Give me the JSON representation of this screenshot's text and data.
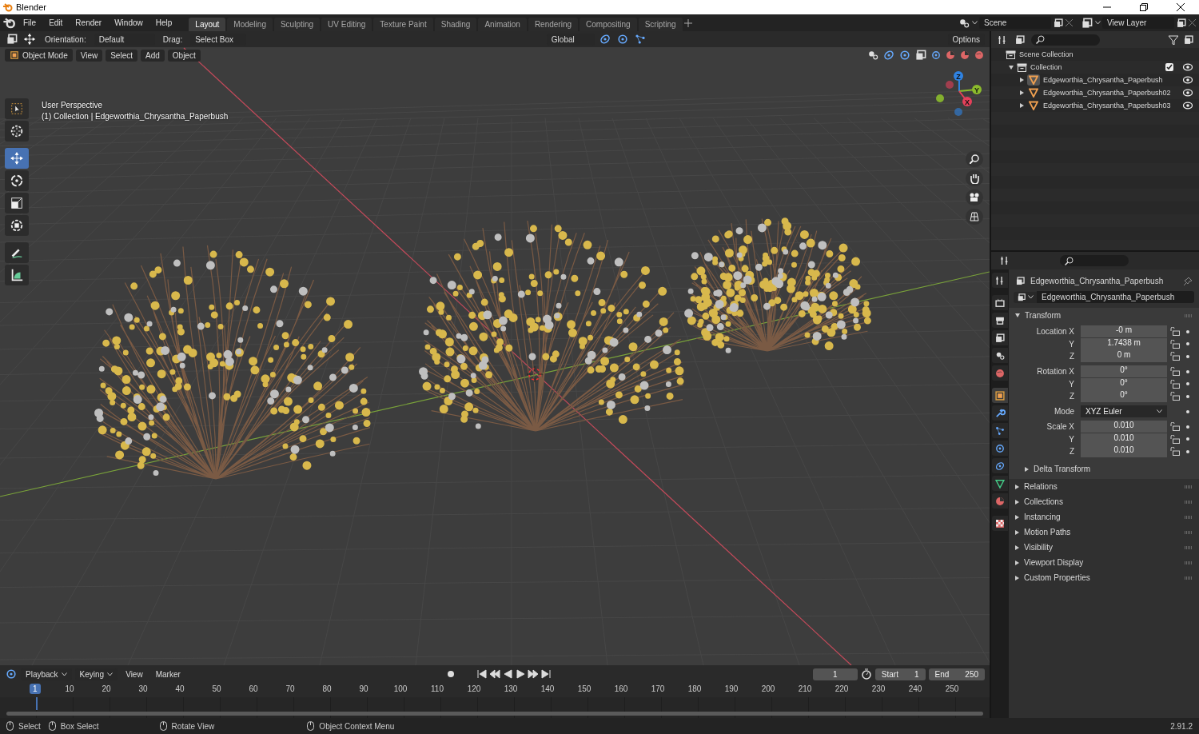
{
  "window": {
    "title": "Blender"
  },
  "menu": [
    "File",
    "Edit",
    "Render",
    "Window",
    "Help"
  ],
  "workspaces": [
    {
      "label": "Layout",
      "selected": true
    },
    {
      "label": "Modeling",
      "selected": false
    },
    {
      "label": "Sculpting",
      "selected": false
    },
    {
      "label": "UV Editing",
      "selected": false
    },
    {
      "label": "Texture Paint",
      "selected": false
    },
    {
      "label": "Shading",
      "selected": false
    },
    {
      "label": "Animation",
      "selected": false
    },
    {
      "label": "Rendering",
      "selected": false
    },
    {
      "label": "Compositing",
      "selected": false
    },
    {
      "label": "Scripting",
      "selected": false
    }
  ],
  "scene": {
    "name": "Scene"
  },
  "view_layer": {
    "name": "View Layer"
  },
  "viewport_header": {
    "orientation_label": "Orientation:",
    "orientation": "Default",
    "drag_label": "Drag:",
    "drag": "Select Box",
    "transform_orientation": "Global",
    "options": "Options",
    "mode": "Object Mode",
    "menus": [
      "View",
      "Select",
      "Add",
      "Object"
    ]
  },
  "tools": [
    {
      "kind": "select",
      "selected": false
    },
    {
      "kind": "cursor",
      "selected": false
    },
    {
      "kind": "move",
      "selected": true
    },
    {
      "kind": "rotate",
      "selected": false
    },
    {
      "kind": "scale",
      "selected": false
    },
    {
      "kind": "transform",
      "selected": false
    },
    {
      "kind": "annotate",
      "selected": false
    },
    {
      "kind": "measure",
      "selected": false
    }
  ],
  "viewport_overlay": {
    "view": "User Perspective",
    "context": "(1) Collection | Edgeworthia_Chrysantha_Paperbush"
  },
  "gizmo_axes": [
    "Z",
    "Y",
    "X"
  ],
  "outliner": {
    "root": "Scene Collection",
    "collection": {
      "name": "Collection",
      "expanded": true,
      "checked": true,
      "children": [
        {
          "name": "Edgeworthia_Chrysantha_Paperbush",
          "selected": true
        },
        {
          "name": "Edgeworthia_Chrysantha_Paperbush02",
          "selected": false
        },
        {
          "name": "Edgeworthia_Chrysantha_Paperbush03",
          "selected": false
        }
      ]
    }
  },
  "properties": {
    "object_name": "Edgeworthia_Chrysantha_Paperbush",
    "data_name": "Edgeworthia_Chrysantha_Paperbush",
    "tabs": [
      {
        "kind": "tool",
        "selected": false
      },
      {
        "kind": "render",
        "selected": false
      },
      {
        "kind": "output",
        "selected": false
      },
      {
        "kind": "viewlayer",
        "selected": false
      },
      {
        "kind": "scene",
        "selected": false
      },
      {
        "kind": "world",
        "selected": false
      },
      {
        "kind": "object",
        "selected": true
      },
      {
        "kind": "modifier",
        "selected": false
      },
      {
        "kind": "particles",
        "selected": false
      },
      {
        "kind": "physics",
        "selected": false
      },
      {
        "kind": "constraints",
        "selected": false
      },
      {
        "kind": "data",
        "selected": false
      },
      {
        "kind": "material",
        "selected": false
      },
      {
        "kind": "texture",
        "selected": false
      }
    ],
    "transform": {
      "title": "Transform",
      "expanded": true,
      "groups": [
        {
          "rows": [
            {
              "kind": "number",
              "label": "Location X",
              "value": "-0 m"
            },
            {
              "kind": "number",
              "label": "Y",
              "value": "1.7438 m"
            },
            {
              "kind": "number",
              "label": "Z",
              "value": "0 m"
            }
          ]
        },
        {
          "rows": [
            {
              "kind": "number",
              "label": "Rotation X",
              "value": "0°"
            },
            {
              "kind": "number",
              "label": "Y",
              "value": "0°"
            },
            {
              "kind": "number",
              "label": "Z",
              "value": "0°"
            }
          ]
        },
        {
          "rows": [
            {
              "kind": "dropdown",
              "label": "Mode",
              "value": "XYZ Euler"
            }
          ]
        },
        {
          "rows": [
            {
              "kind": "number",
              "label": "Scale X",
              "value": "0.010"
            },
            {
              "kind": "number",
              "label": "Y",
              "value": "0.010"
            },
            {
              "kind": "number",
              "label": "Z",
              "value": "0.010"
            }
          ]
        }
      ],
      "subpanel": {
        "title": "Delta Transform",
        "expanded": false
      }
    },
    "panels": [
      {
        "title": "Relations",
        "expanded": false
      },
      {
        "title": "Collections",
        "expanded": false
      },
      {
        "title": "Instancing",
        "expanded": false
      },
      {
        "title": "Motion Paths",
        "expanded": false
      },
      {
        "title": "Visibility",
        "expanded": false
      },
      {
        "title": "Viewport Display",
        "expanded": false
      },
      {
        "title": "Custom Properties",
        "expanded": false
      }
    ]
  },
  "timeline": {
    "menus": [
      {
        "label": "Playback",
        "dropdown": true
      },
      {
        "label": "Keying",
        "dropdown": true
      },
      {
        "label": "View",
        "dropdown": false
      },
      {
        "label": "Marker",
        "dropdown": false
      }
    ],
    "current_frame": "1",
    "start_label": "Start",
    "start": "1",
    "end_label": "End",
    "end": "250",
    "playhead": "1",
    "ruler": [
      "10",
      "20",
      "30",
      "40",
      "50",
      "60",
      "70",
      "80",
      "90",
      "100",
      "110",
      "120",
      "130",
      "140",
      "150",
      "160",
      "170",
      "180",
      "190",
      "200",
      "210",
      "220",
      "230",
      "240",
      "250"
    ]
  },
  "status_bar": {
    "hints": [
      "Select",
      "Box Select",
      "Rotate View",
      "Object Context Menu"
    ],
    "version": "2.91.2"
  }
}
